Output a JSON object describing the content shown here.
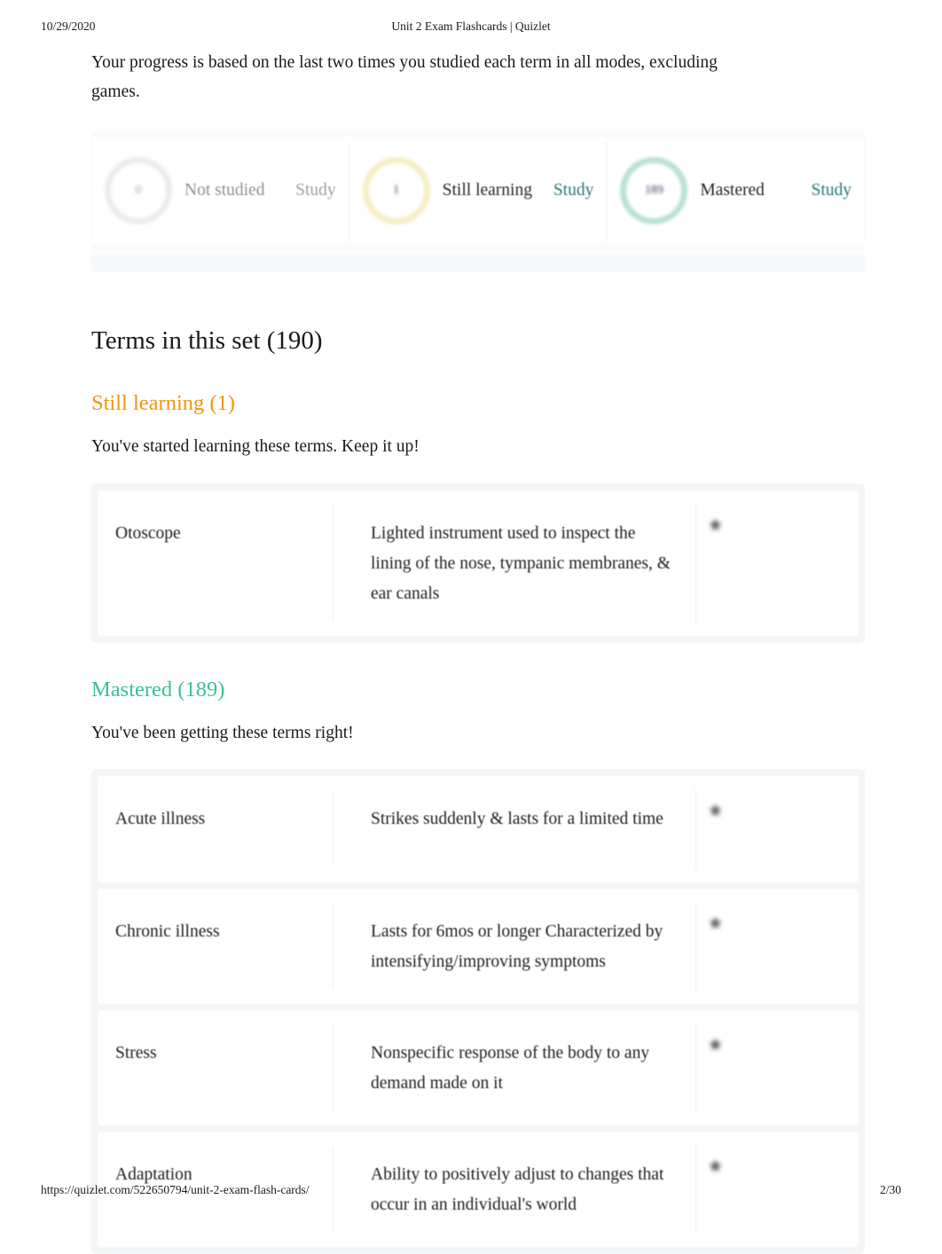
{
  "print_header": {
    "date": "10/29/2020",
    "title": "Unit 2 Exam Flashcards | Quizlet"
  },
  "print_footer": {
    "url": "https://quizlet.com/522650794/unit-2-exam-flash-cards/",
    "page": "2/30"
  },
  "intro": {
    "text": "Your progress is based on the last two times you studied each term in all modes, excluding games."
  },
  "colors": {
    "still_learning_accent": "#f0950e",
    "mastered_accent": "#3ac194",
    "study_link_teal": "#2b7a78",
    "study_link_muted": "#9aa0a6",
    "ring_not_studied": "#e9ecef",
    "ring_still_learning": "#f5eec3",
    "ring_mastered": "#b9e2d2"
  },
  "progress": {
    "cards": [
      {
        "count": "0",
        "label": "Not studied",
        "study_label": "Study",
        "state": "muted"
      },
      {
        "count": "1",
        "label": "Still learning",
        "study_label": "Study",
        "state": "active"
      },
      {
        "count": "189",
        "label": "Mastered",
        "study_label": "Study",
        "state": "active"
      }
    ]
  },
  "terms_section": {
    "title": "Terms in this set (190)",
    "groups": [
      {
        "heading": "Still learning (1)",
        "subtitle": "You've started learning these terms. Keep it up!",
        "cards": [
          {
            "term": "Otoscope",
            "definition": "Lighted instrument used to inspect the lining of the nose, tympanic membranes, & ear canals",
            "icon": "star-icon"
          }
        ]
      },
      {
        "heading": "Mastered (189)",
        "subtitle": "You've been getting these terms right!",
        "cards": [
          {
            "term": "Acute illness",
            "definition": "Strikes suddenly & lasts for a limited time",
            "icon": "star-icon"
          },
          {
            "term": "Chronic illness",
            "definition": "Lasts for 6mos or longer Characterized by intensifying/improving symptoms",
            "icon": "star-icon"
          },
          {
            "term": "Stress",
            "definition": "Nonspecific response of the body to any demand made on it",
            "icon": "star-icon"
          },
          {
            "term": "Adaptation",
            "definition": "Ability to positively adjust to changes that occur in an individual's world",
            "icon": "star-icon"
          }
        ]
      }
    ]
  }
}
